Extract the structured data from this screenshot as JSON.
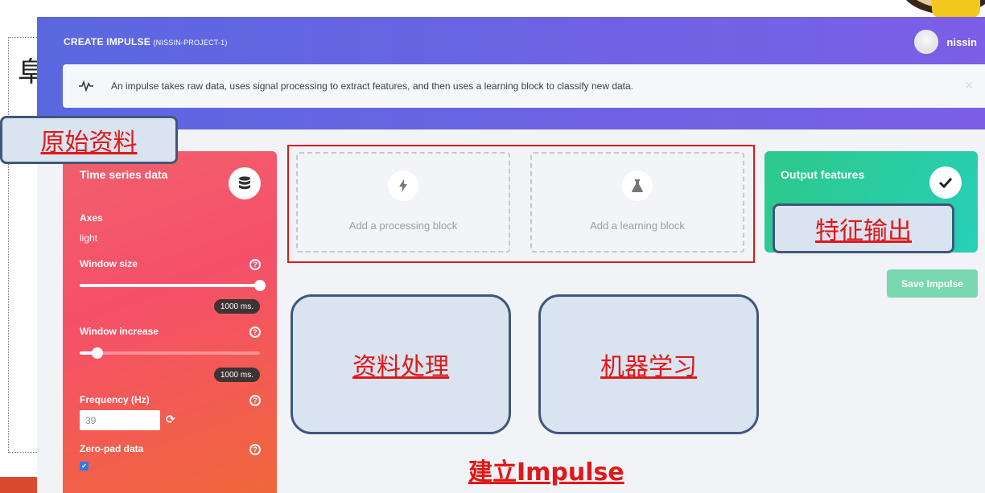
{
  "slide": {
    "fragment_char": "阜",
    "callout_raw_data": "原始资料",
    "callout_features": "特征输出",
    "callout_processing": "资料处理",
    "callout_learning": "机器学习",
    "footer_title": "建立Impulse"
  },
  "header": {
    "title": "CREATE IMPULSE",
    "project": "(NISSIN-PROJECT-1)",
    "username": "nissin",
    "info_text": "An impulse takes raw data, uses signal processing to extract features, and then uses a learning block to classify new data.",
    "info_icon": "pulse-icon",
    "close_icon": "close-icon"
  },
  "time_series": {
    "title": "Time series data",
    "icon": "database-icon",
    "axes_label": "Axes",
    "axes_value": "light",
    "window_size_label": "Window size",
    "window_size_value": "1000 ms.",
    "window_size_fraction": 1.0,
    "window_increase_label": "Window increase",
    "window_increase_value": "1000 ms.",
    "window_increase_fraction": 0.1,
    "frequency_label": "Frequency (Hz)",
    "frequency_value": "39",
    "zero_pad_label": "Zero-pad data",
    "zero_pad_checked": true
  },
  "blocks": {
    "processing_label": "Add a processing block",
    "processing_icon": "lightning-icon",
    "learning_label": "Add a learning block",
    "learning_icon": "flask-icon"
  },
  "output": {
    "title": "Output features",
    "icon": "checkmark-icon",
    "save_label": "Save Impulse"
  },
  "colors": {
    "header_start": "#5a68e0",
    "header_end": "#7b5fe6",
    "ts_card": "#f5506a",
    "output_card": "#2cc989",
    "save_button": "#79d8ad",
    "annotation_red": "#e01818"
  }
}
